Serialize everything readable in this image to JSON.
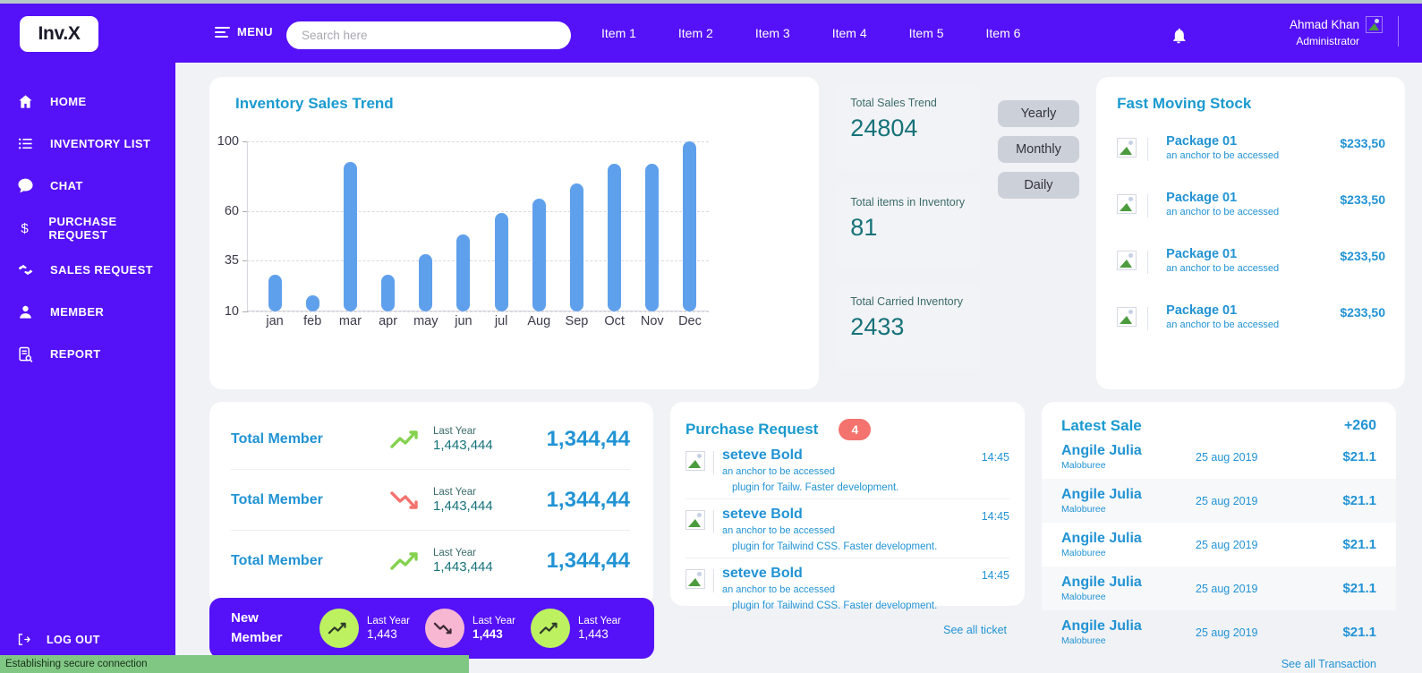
{
  "brand": {
    "logo": "Inv.X"
  },
  "topbar": {
    "menu_label": "MENU",
    "search_placeholder": "Search here",
    "nav_items": [
      "Item 1",
      "Item 2",
      "Item 3",
      "Item 4",
      "Item 5",
      "Item 6"
    ],
    "user": {
      "name": "Ahmad Khan",
      "role": "Administrator"
    }
  },
  "sidebar": {
    "items": [
      {
        "label": "HOME",
        "icon": "home-icon"
      },
      {
        "label": "INVENTORY LIST",
        "icon": "list-icon"
      },
      {
        "label": "CHAT",
        "icon": "chat-bubble-icon"
      },
      {
        "label": "PURCHASE REQUEST",
        "icon": "dollar-icon"
      },
      {
        "label": "SALES REQUEST",
        "icon": "handshake-icon"
      },
      {
        "label": "MEMBER",
        "icon": "user-icon"
      },
      {
        "label": "REPORT",
        "icon": "report-search-icon"
      }
    ],
    "logout": "LOG OUT"
  },
  "chart_data": {
    "type": "bar",
    "title": "Inventory Sales Trend",
    "categories": [
      "jan",
      "feb",
      "mar",
      "apr",
      "may",
      "jun",
      "jul",
      "Aug",
      "Sep",
      "Oct",
      "Nov",
      "Dec"
    ],
    "values": [
      28,
      18,
      88,
      28,
      38,
      48,
      59,
      67,
      76,
      87,
      87,
      100
    ],
    "xlabel": "",
    "ylabel": "",
    "yticks": [
      10,
      35,
      60,
      100
    ],
    "ylim": [
      10,
      100
    ],
    "grid": true,
    "legend": "none",
    "bar_color": "#5fa0ec"
  },
  "stats": [
    {
      "label": "Total Sales Trend",
      "value": "24804"
    },
    {
      "label": "Total items in Inventory",
      "value": "81"
    },
    {
      "label": "Total Carried Inventory",
      "value": "2433"
    }
  ],
  "period_buttons": [
    "Yearly",
    "Monthly",
    "Daily"
  ],
  "fast_moving_stock": {
    "title": "Fast Moving Stock",
    "items": [
      {
        "name": "Package 01",
        "subtitle": "an anchor to be accessed",
        "price": "$233,50"
      },
      {
        "name": "Package 01",
        "subtitle": "an anchor to be accessed",
        "price": "$233,50"
      },
      {
        "name": "Package 01",
        "subtitle": "an anchor to be accessed",
        "price": "$233,50"
      },
      {
        "name": "Package 01",
        "subtitle": "an anchor to be accessed",
        "price": "$233,50"
      }
    ]
  },
  "member_panel": {
    "rows": [
      {
        "label": "Total Member",
        "trend": "up",
        "last_year_label": "Last Year",
        "last_year_value": "1,443,444",
        "value": "1,344,44"
      },
      {
        "label": "Total Member",
        "trend": "down",
        "last_year_label": "Last Year",
        "last_year_value": "1,443,444",
        "value": "1,344,44"
      },
      {
        "label": "Total Member",
        "trend": "up",
        "last_year_label": "Last Year",
        "last_year_value": "1,443,444",
        "value": "1,344,44"
      }
    ]
  },
  "purchase_request": {
    "title": "Purchase Request",
    "badge": "4",
    "items": [
      {
        "name": "seteve Bold",
        "subtitle": "an anchor to be accessed",
        "desc": "plugin for Tailw. Faster development.",
        "time": "14:45"
      },
      {
        "name": "seteve Bold",
        "subtitle": "an anchor to be accessed",
        "desc": "plugin for Tailwind CSS. Faster development.",
        "time": "14:45"
      },
      {
        "name": "seteve Bold",
        "subtitle": "an anchor to be accessed",
        "desc": "plugin for Tailwind CSS. Faster development.",
        "time": "14:45"
      }
    ],
    "footer": "See all ticket"
  },
  "latest_sale": {
    "title": "Latest Sale",
    "total": "+260",
    "rows": [
      {
        "name": "Angile Julia",
        "company": "Maloburee",
        "date": "25 aug 2019",
        "amount": "$21.1"
      },
      {
        "name": "Angile Julia",
        "company": "Maloburee",
        "date": "25 aug 2019",
        "amount": "$21.1"
      },
      {
        "name": "Angile Julia",
        "company": "Maloburee",
        "date": "25 aug 2019",
        "amount": "$21.1"
      },
      {
        "name": "Angile Julia",
        "company": "Maloburee",
        "date": "25 aug 2019",
        "amount": "$21.1"
      },
      {
        "name": "Angile Julia",
        "company": "Maloburee",
        "date": "25 aug 2019",
        "amount": "$21.1"
      }
    ],
    "footer": "See all Transaction"
  },
  "new_member": {
    "label": "New Member",
    "items": [
      {
        "trend": "up",
        "last_year_label": "Last Year",
        "value": "1,443"
      },
      {
        "trend": "down",
        "last_year_label": "Last Year",
        "value": "1,443"
      },
      {
        "trend": "up",
        "last_year_label": "Last Year",
        "value": "1,443"
      }
    ]
  },
  "status_bar": {
    "text": "Establishing secure connection"
  },
  "colors": {
    "brand_purple": "#5511f8",
    "accent_blue": "#2193d4",
    "teal": "#16727a",
    "bar_blue": "#5fa0ec",
    "badge_red": "#f4736e",
    "status_green": "#81c784"
  }
}
